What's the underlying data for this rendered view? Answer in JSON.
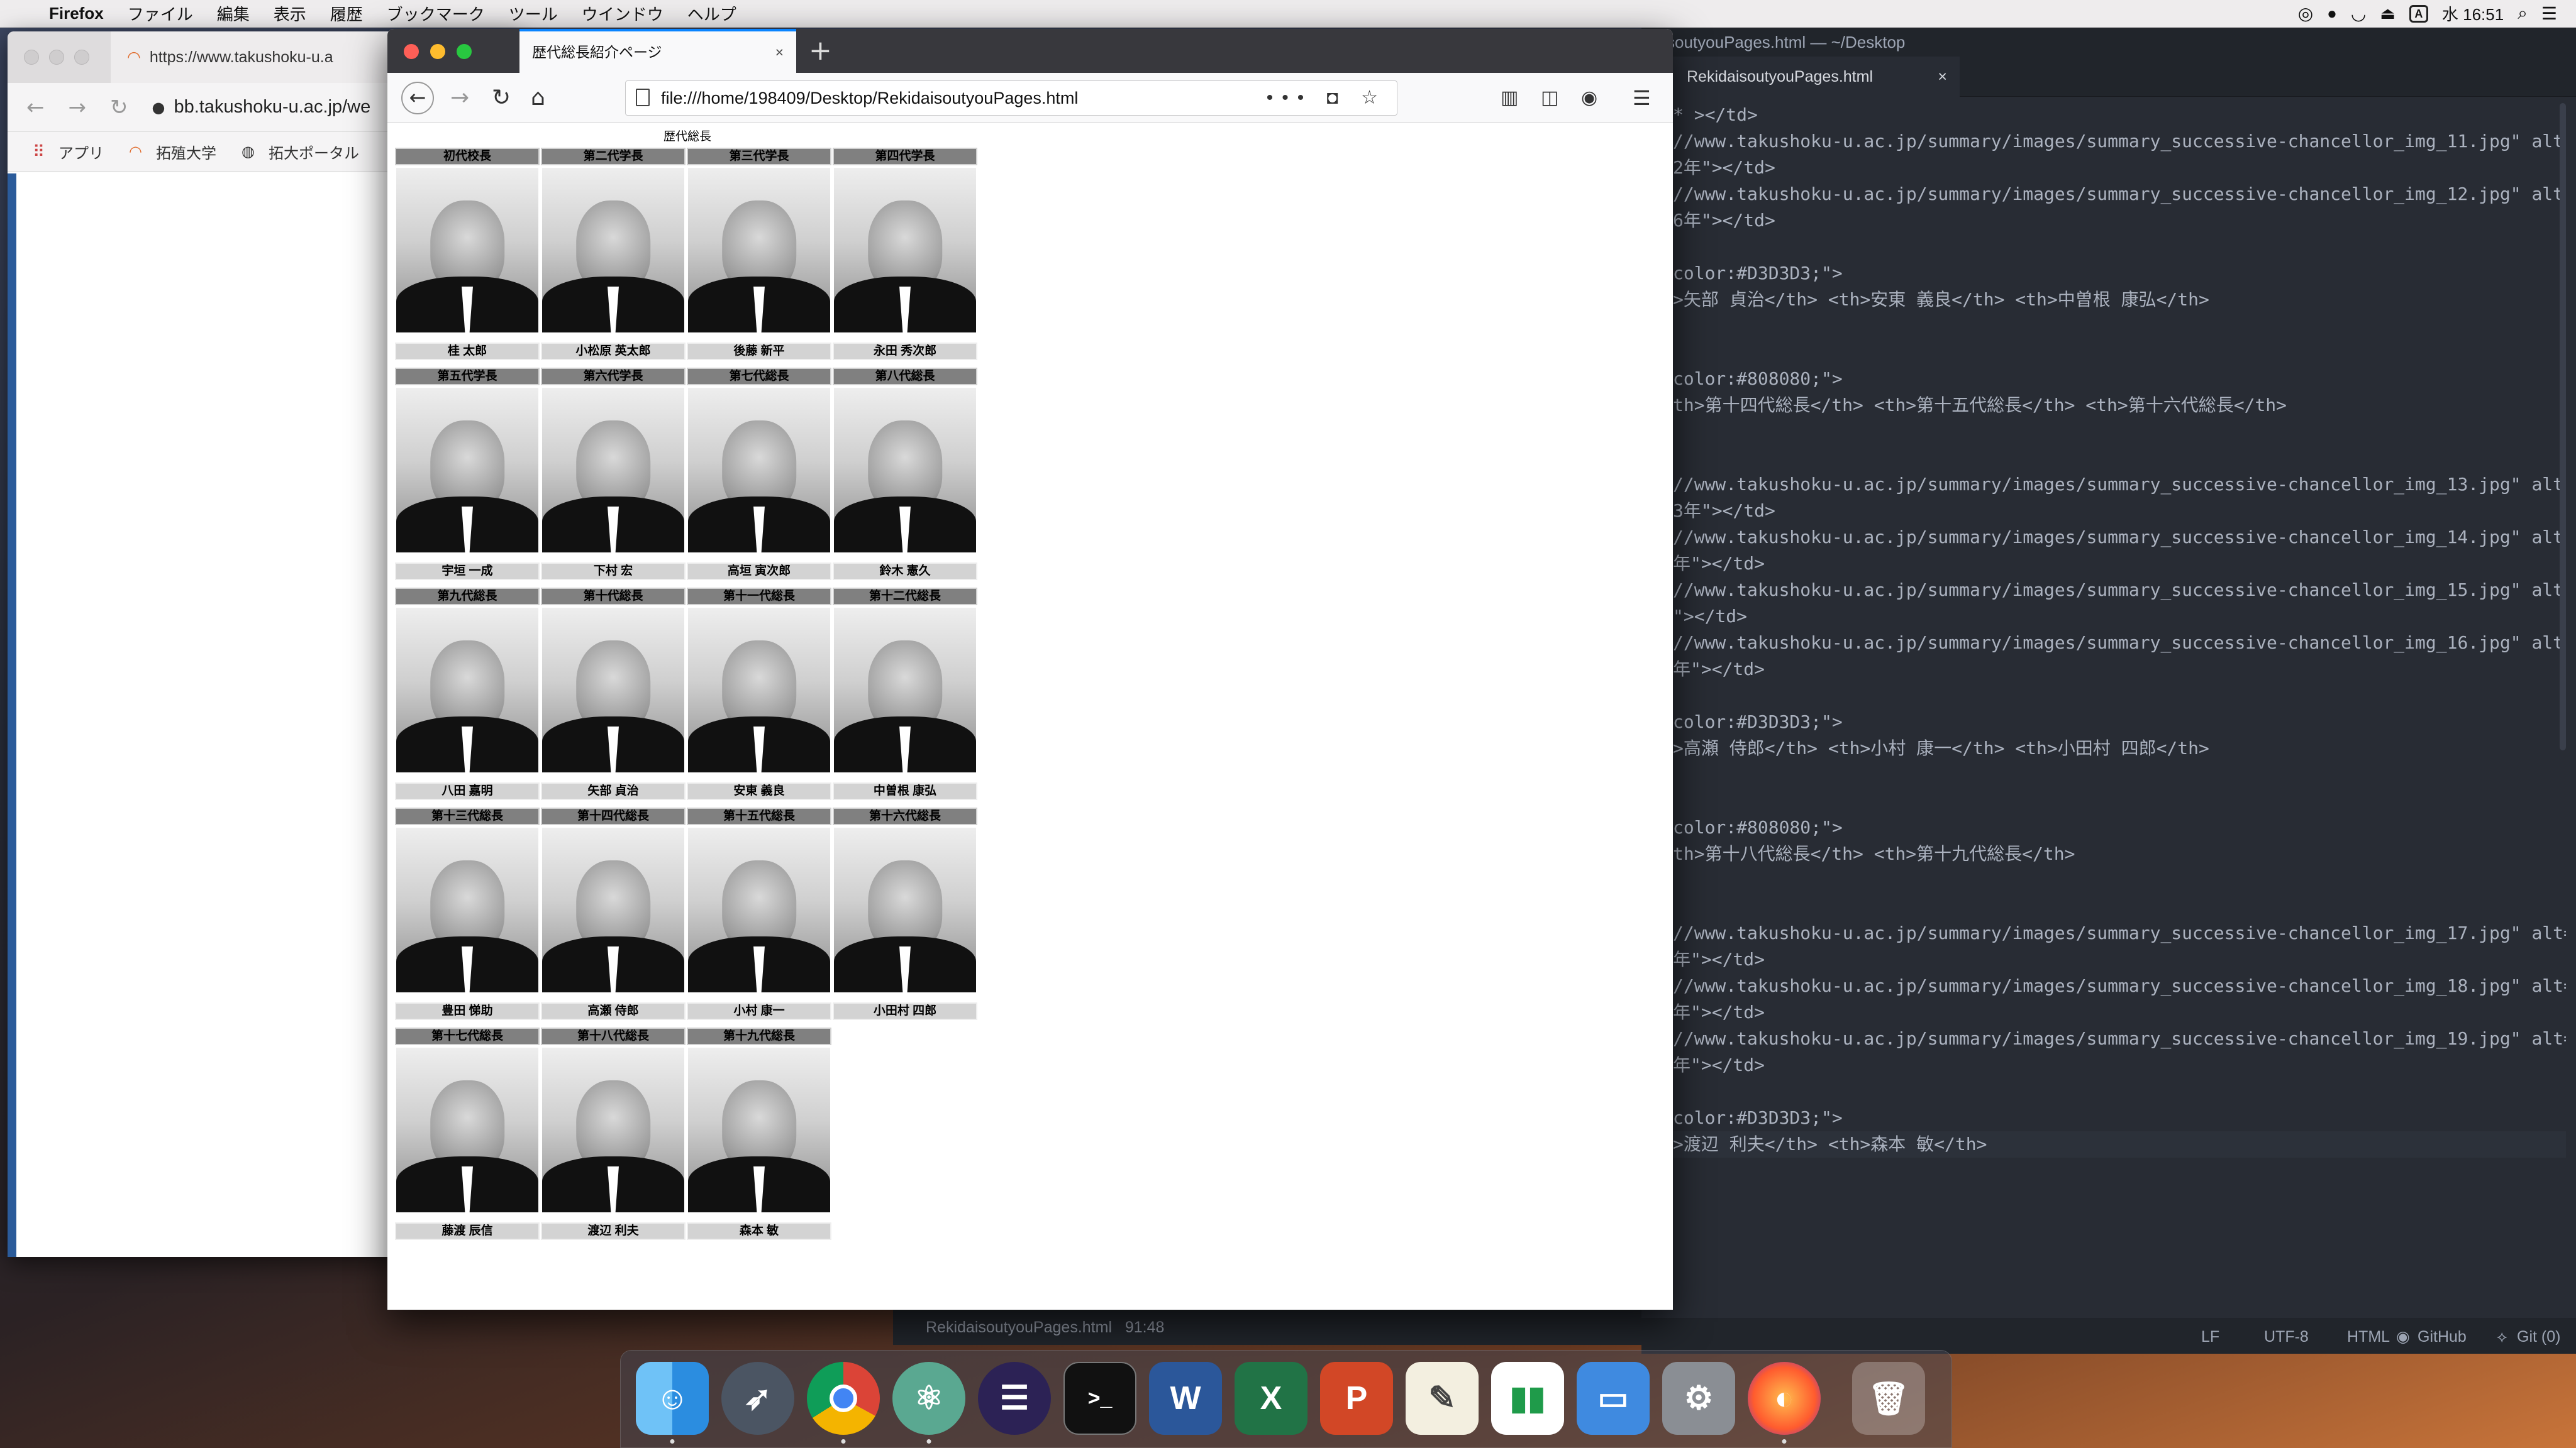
{
  "menubar": {
    "apple": "",
    "app": "Firefox",
    "items": [
      "ファイル",
      "編集",
      "表示",
      "履歴",
      "ブックマーク",
      "ツール",
      "ウインドウ",
      "ヘルプ"
    ],
    "time": "水 16:51",
    "input_label": "A"
  },
  "back_window": {
    "tab_title": "https://www.takushoku-u.a",
    "url": "bb.takushoku-u.ac.jp/we",
    "bookmarks": [
      "アプリ",
      "拓殖大学",
      "拓大ポータル"
    ]
  },
  "firefox": {
    "tab_title": "歴代総長紹介ページ",
    "close": "×",
    "new_tab": "+",
    "url": "file:///home/198409/Desktop/RekidaisoutyouPages.html",
    "url_actions": "••• ◘ ☆",
    "page": {
      "caption": "歴代総長",
      "rows": [
        {
          "headers": [
            "初代校長",
            "第二代学長",
            "第三代学長",
            "第四代学長"
          ],
          "names": [
            "桂 太郎",
            "小松原 英太郎",
            "後藤 新平",
            "永田 秀次郎"
          ]
        },
        {
          "headers": [
            "第五代学長",
            "第六代学長",
            "第七代総長",
            "第八代総長"
          ],
          "names": [
            "宇垣 一成",
            "下村 宏",
            "高垣 寅次郎",
            "鈴木 憲久"
          ]
        },
        {
          "headers": [
            "第九代総長",
            "第十代総長",
            "第十一代総長",
            "第十二代総長"
          ],
          "names": [
            "八田 嘉明",
            "矢部 貞治",
            "安東 義良",
            "中曽根 康弘"
          ]
        },
        {
          "headers": [
            "第十三代総長",
            "第十四代総長",
            "第十五代総長",
            "第十六代総長"
          ],
          "names": [
            "豊田 悌助",
            "高瀬 侍郎",
            "小村 康一",
            "小田村 四郎"
          ]
        },
        {
          "headers": [
            "第十七代総長",
            "第十八代総長",
            "第十九代総長"
          ],
          "names": [
            "藤渡 辰信",
            "渡辺 利夫",
            "森本 敏"
          ]
        }
      ]
    }
  },
  "editor": {
    "title": "soutyouPages.html — ~/Desktop",
    "tab": "RekidaisoutyouPages.html",
    "tab_close": "×",
    "lines": [
      "* ></td>",
      "//www.takushoku-u.ac.jp/summary/images/summary_successive-chancellor_img_11.jpg\" alt=",
      "2年\"></td>",
      "//www.takushoku-u.ac.jp/summary/images/summary_successive-chancellor_img_12.jpg\" alt=",
      "6年\"></td>",
      "",
      "color:#D3D3D3;\">",
      ">矢部 貞治</th> <th>安東 義良</th> <th>中曽根 康弘</th>",
      "",
      "",
      "color:#808080;\">",
      "th>第十四代総長</th> <th>第十五代総長</th> <th>第十六代総長</th>",
      "",
      "",
      "//www.takushoku-u.ac.jp/summary/images/summary_successive-chancellor_img_13.jpg\" alt=",
      "3年\"></td>",
      "//www.takushoku-u.ac.jp/summary/images/summary_successive-chancellor_img_14.jpg\" alt=",
      "年\"></td>",
      "//www.takushoku-u.ac.jp/summary/images/summary_successive-chancellor_img_15.jpg\" alt=",
      "\"></td>",
      "//www.takushoku-u.ac.jp/summary/images/summary_successive-chancellor_img_16.jpg\" alt=",
      "年\"></td>",
      "",
      "color:#D3D3D3;\">",
      ">高瀬 侍郎</th> <th>小村 康一</th> <th>小田村 四郎</th>",
      "",
      "",
      "color:#808080;\">",
      "th>第十八代総長</th> <th>第十九代総長</th>",
      "",
      "",
      "//www.takushoku-u.ac.jp/summary/images/summary_successive-chancellor_img_17.jpg\" alt=",
      "年\"></td>",
      "//www.takushoku-u.ac.jp/summary/images/summary_successive-chancellor_img_18.jpg\" alt=",
      "年\"></td>",
      "//www.takushoku-u.ac.jp/summary/images/summary_successive-chancellor_img_19.jpg\" alt=",
      "年\"></td>",
      "",
      "color:#D3D3D3;\">",
      ">渡辺 利夫</th> <th>森本 敏</th>"
    ],
    "status_left": "RekidaisoutyouPages.html   91:48",
    "status_items": [
      "LF",
      "UTF-8",
      "HTML",
      "GitHub",
      "Git (0)"
    ]
  },
  "dock": {
    "apps": [
      "Finder",
      "Launchpad",
      "Chrome",
      "Atom",
      "Eclipse",
      "Terminal",
      "Word",
      "Excel",
      "PowerPoint",
      "TextEdit",
      "Numbers",
      "Keynote",
      "System Preferences",
      "Firefox",
      "Trash"
    ]
  }
}
